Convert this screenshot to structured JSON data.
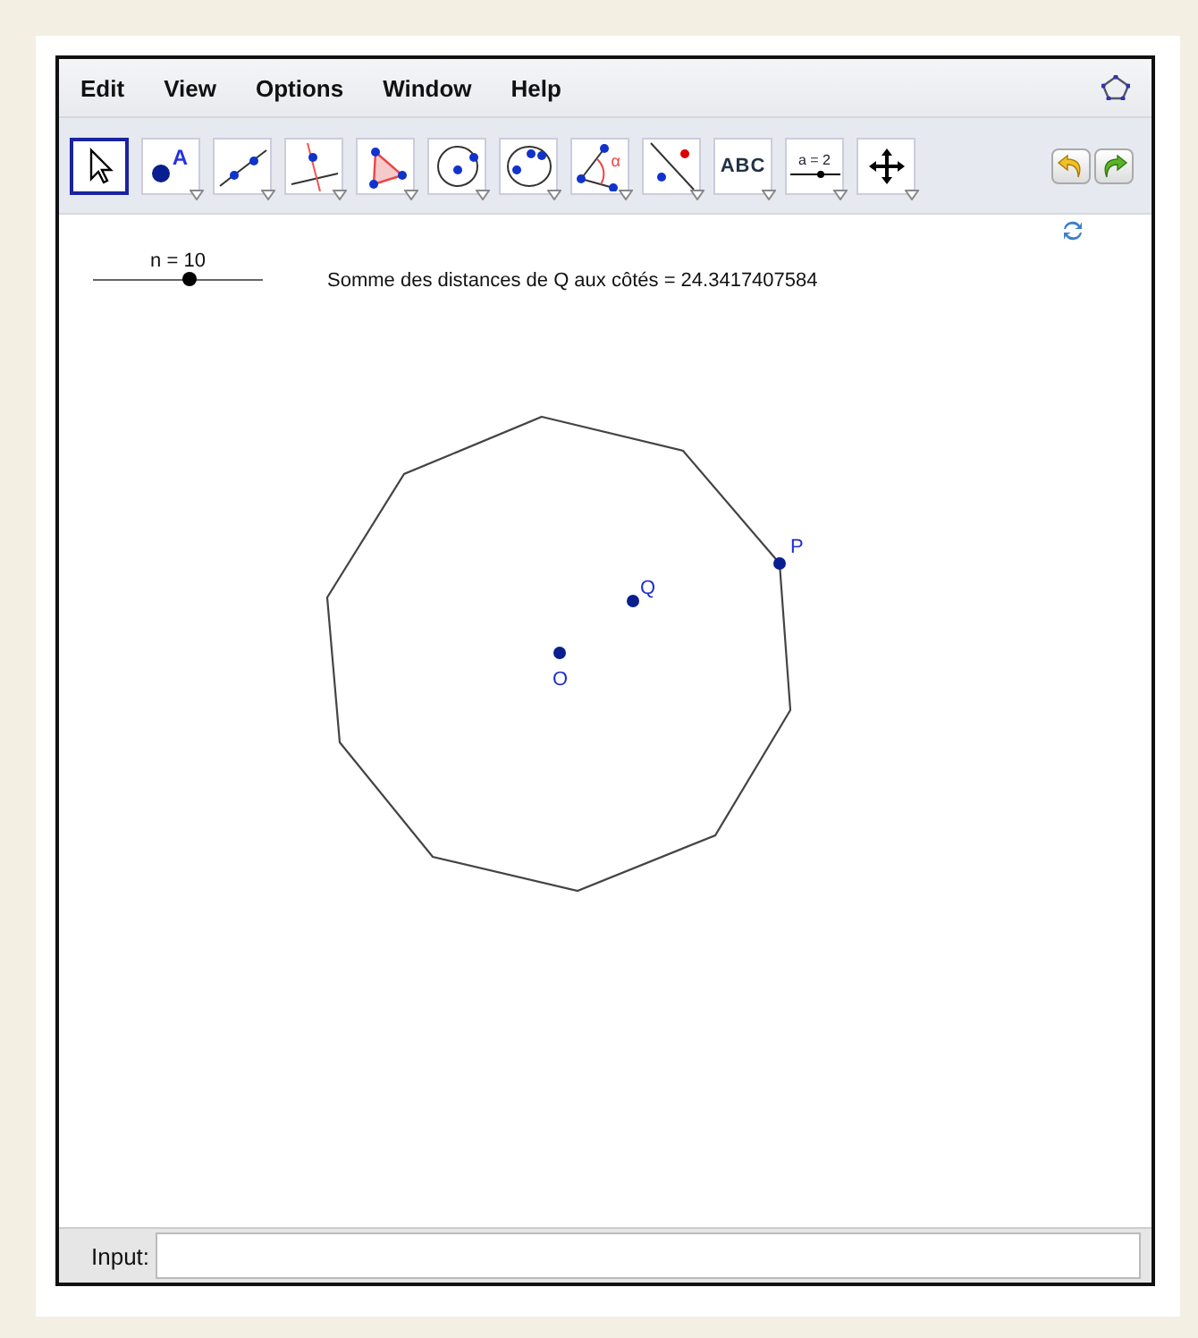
{
  "menu": [
    "Edit",
    "View",
    "Options",
    "Window",
    "Help"
  ],
  "toolbar": {
    "tools": [
      {
        "kind": "move",
        "selected": true
      },
      {
        "kind": "point",
        "label": "A",
        "selected": false
      },
      {
        "kind": "line",
        "selected": false
      },
      {
        "kind": "perpendicular",
        "selected": false
      },
      {
        "kind": "polygon",
        "selected": false
      },
      {
        "kind": "circle",
        "selected": false
      },
      {
        "kind": "conic",
        "selected": false
      },
      {
        "kind": "angle",
        "label": "α",
        "selected": false
      },
      {
        "kind": "reflect",
        "selected": false
      },
      {
        "kind": "text",
        "label": "ABC",
        "selected": false
      },
      {
        "kind": "slider",
        "label": "a = 2",
        "selected": false
      },
      {
        "kind": "pan",
        "selected": false
      }
    ]
  },
  "slider": {
    "label": "n = 10",
    "level": 0.57
  },
  "caption": "Somme des distances de Q aux côtés = 24.3417407584",
  "points": [
    {
      "label": "P"
    },
    {
      "label": "Q"
    },
    {
      "label": "O"
    }
  ],
  "input_bar": {
    "label": "Input:"
  }
}
